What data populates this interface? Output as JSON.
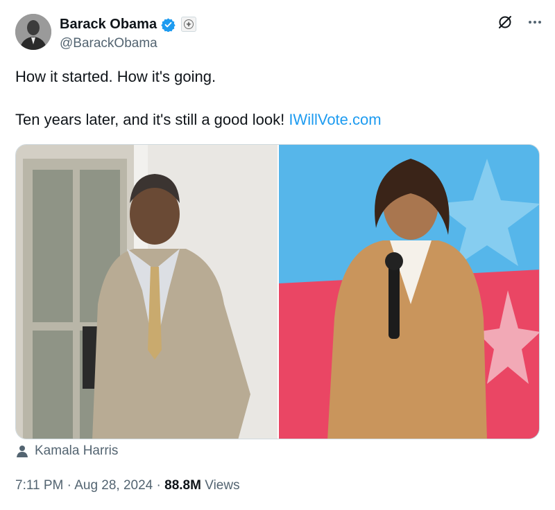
{
  "author": {
    "display_name": "Barack Obama",
    "handle": "@BarackObama",
    "verified_icon": "verified-badge-icon",
    "affiliation_icon": "government-seal-icon"
  },
  "tweet": {
    "line1": "How it started. How it's going.",
    "line2_prefix": "Ten years later, and it's still a good look! ",
    "link_text": "IWillVote.com"
  },
  "tagged_user": "Kamala Harris",
  "meta": {
    "time": "7:11 PM",
    "separator": "·",
    "date": "Aug 28, 2024",
    "views_count": "88.8M",
    "views_label": "Views"
  },
  "colors": {
    "link": "#1d9bf0",
    "verified": "#1d9bf0",
    "secondary_text": "#536471"
  }
}
